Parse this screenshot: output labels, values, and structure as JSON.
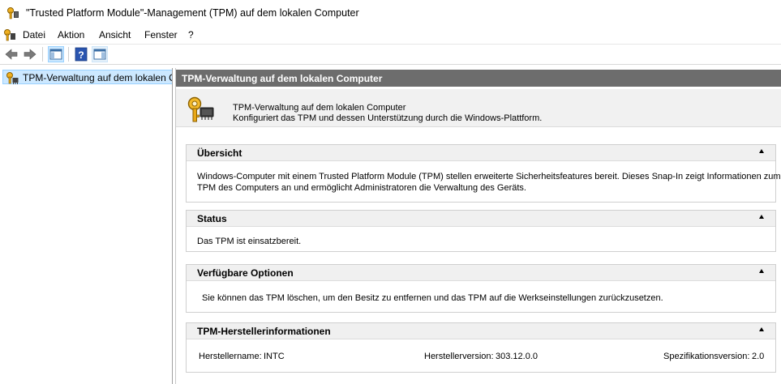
{
  "window": {
    "title": "\"Trusted Platform Module\"-Management (TPM) auf dem lokalen Computer",
    "icon": "tpm-key-icon"
  },
  "menu": [
    "Datei",
    "Aktion",
    "Ansicht",
    "Fenster",
    "?"
  ],
  "toolbar": {
    "buttons": [
      "back-arrow-icon",
      "forward-arrow-icon",
      "show-hide-tree-icon",
      "help-icon",
      "action-pane-icon"
    ]
  },
  "tree": {
    "selected_item": "TPM-Verwaltung auf dem lokalen Computer"
  },
  "main": {
    "header": "TPM-Verwaltung auf dem lokalen Computer",
    "intro": {
      "line1": "TPM-Verwaltung auf dem lokalen Computer",
      "line2": "Konfiguriert das TPM und dessen Unterstützung durch die Windows-Plattform."
    },
    "sections": {
      "overview": {
        "title": "Übersicht",
        "line1": "Windows-Computer mit einem Trusted Platform Module (TPM) stellen erweiterte Sicherheitsfeatures bereit. Dieses Snap-In zeigt Informationen zum",
        "line2": "TPM des Computers an und ermöglicht Administratoren die Verwaltung des Geräts."
      },
      "status": {
        "title": "Status",
        "text": "Das TPM ist einsatzbereit."
      },
      "options": {
        "title": "Verfügbare Optionen",
        "text": "Sie können das TPM löschen, um den Besitz zu entfernen und das TPM auf die Werkseinstellungen zurückzusetzen."
      },
      "manufacturer": {
        "title": "TPM-Herstellerinformationen",
        "name_label": "Herstellername:",
        "name_value": "INTC",
        "version_label": "Herstellerversion:",
        "version_value": "303.12.0.0",
        "spec_label": "Spezifikationsversion:",
        "spec_value": "2.0"
      }
    }
  }
}
